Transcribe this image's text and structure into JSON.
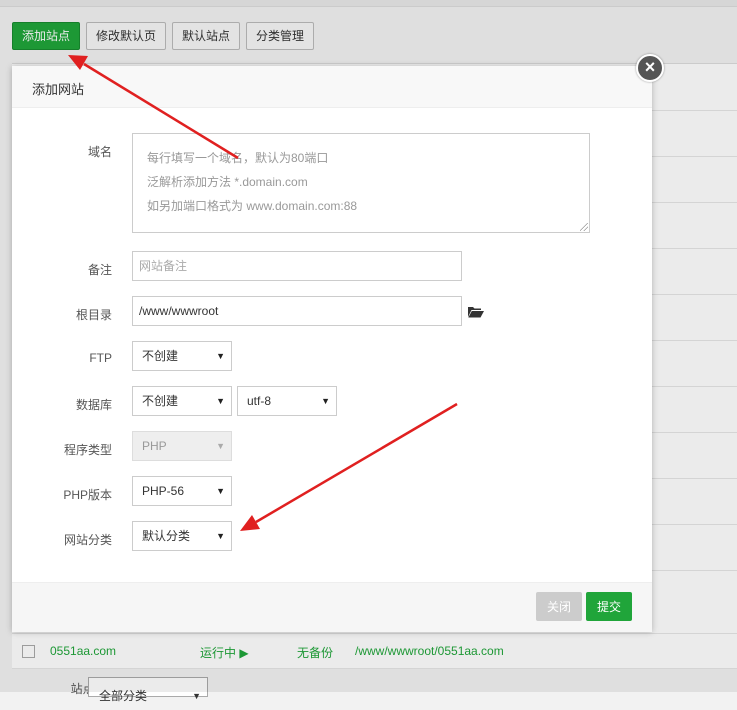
{
  "toolbar": {
    "add_site": "添加站点",
    "edit_default_page": "修改默认页",
    "default_site": "默认站点",
    "category_manage": "分类管理"
  },
  "background_row": {
    "domain": "0551aa.com",
    "status": "运行中 ▶",
    "backup": "无备份",
    "path": "/www/wwwroot/0551aa.com"
  },
  "footer_filter": {
    "label": "站点分类:",
    "value": "全部分类"
  },
  "modal": {
    "title": "添加网站",
    "close_icon": "close-x",
    "fields": {
      "domain": {
        "label": "域名",
        "placeholder_lines": [
          "每行填写一个域名，默认为80端口",
          "泛解析添加方法 *.domain.com",
          "如另加端口格式为 www.domain.com:88"
        ]
      },
      "remark": {
        "label": "备注",
        "placeholder": "网站备注"
      },
      "root_dir": {
        "label": "根目录",
        "value": "/www/wwwroot",
        "icon": "folder-open-icon"
      },
      "ftp": {
        "label": "FTP",
        "value": "不创建"
      },
      "database": {
        "label": "数据库",
        "value": "不创建",
        "charset": "utf-8"
      },
      "program_type": {
        "label": "程序类型",
        "value": "PHP"
      },
      "php_version": {
        "label": "PHP版本",
        "value": "PHP-56"
      },
      "site_category": {
        "label": "网站分类",
        "value": "默认分类"
      }
    },
    "buttons": {
      "close": "关闭",
      "submit": "提交"
    }
  },
  "colors": {
    "accent_green": "#20a53a",
    "annotation_red": "#e02020"
  }
}
